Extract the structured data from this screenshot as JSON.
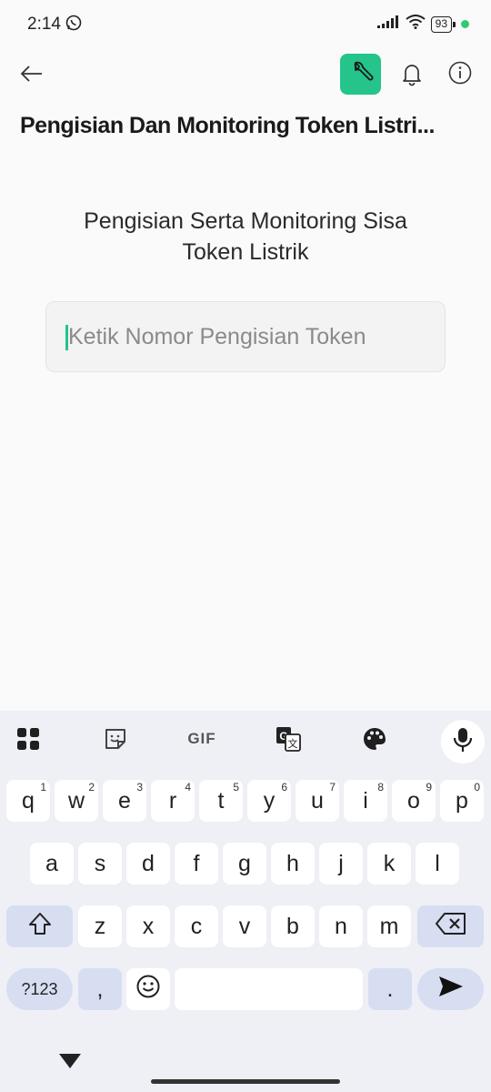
{
  "status": {
    "time": "2:14",
    "battery": "93"
  },
  "app": {
    "title": "Pengisian Dan Monitoring Token Listri...",
    "heading_line1": "Pengisian Serta Monitoring Sisa",
    "heading_line2": "Token Listrik",
    "input_placeholder": "Ketik Nomor Pengisian Token",
    "accent_color": "#24c48a"
  },
  "keyboard": {
    "toolbar": [
      "apps-grid-icon",
      "sticker-icon",
      "GIF",
      "translate-icon",
      "palette-icon",
      "mic-icon"
    ],
    "gif_label": "GIF",
    "row1": [
      {
        "k": "q",
        "n": "1"
      },
      {
        "k": "w",
        "n": "2"
      },
      {
        "k": "e",
        "n": "3"
      },
      {
        "k": "r",
        "n": "4"
      },
      {
        "k": "t",
        "n": "5"
      },
      {
        "k": "y",
        "n": "6"
      },
      {
        "k": "u",
        "n": "7"
      },
      {
        "k": "i",
        "n": "8"
      },
      {
        "k": "o",
        "n": "9"
      },
      {
        "k": "p",
        "n": "0"
      }
    ],
    "row2": [
      "a",
      "s",
      "d",
      "f",
      "g",
      "h",
      "j",
      "k",
      "l"
    ],
    "row3": [
      "z",
      "x",
      "c",
      "v",
      "b",
      "n",
      "m"
    ],
    "symbols_label": "?123",
    "comma": ",",
    "period": "."
  }
}
